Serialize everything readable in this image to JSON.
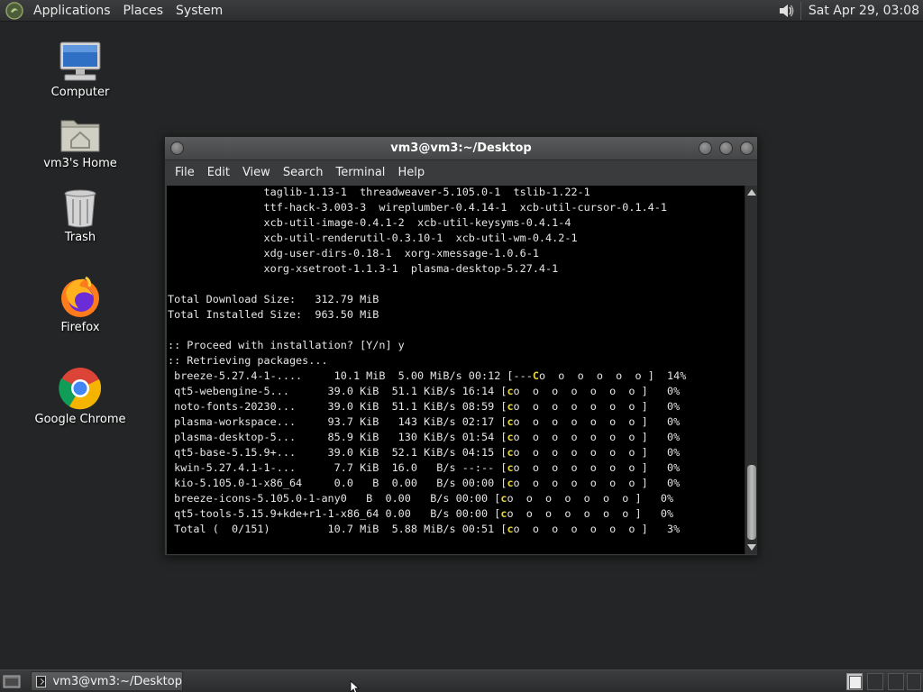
{
  "top_panel": {
    "menus": [
      "Applications",
      "Places",
      "System"
    ],
    "clock": "Sat Apr 29, 03:08",
    "volume_icon": "speaker-icon"
  },
  "desktop": {
    "icons": [
      {
        "label": "Computer",
        "icon": "computer-icon"
      },
      {
        "label": "vm3's Home",
        "icon": "home-folder-icon"
      },
      {
        "label": "Trash",
        "icon": "trash-icon"
      },
      {
        "label": "Firefox",
        "icon": "firefox-icon"
      },
      {
        "label": "Google Chrome",
        "icon": "chrome-icon"
      }
    ]
  },
  "terminal": {
    "title": "vm3@vm3:~/Desktop",
    "menus": [
      "File",
      "Edit",
      "View",
      "Search",
      "Terminal",
      "Help"
    ],
    "lines": [
      "               taglib-1.13-1  threadweaver-5.105.0-1  tslib-1.22-1",
      "               ttf-hack-3.003-3  wireplumber-0.4.14-1  xcb-util-cursor-0.1.4-1",
      "               xcb-util-image-0.4.1-2  xcb-util-keysyms-0.4.1-4",
      "               xcb-util-renderutil-0.3.10-1  xcb-util-wm-0.4.2-1",
      "               xdg-user-dirs-0.18-1  xorg-xmessage-1.0.6-1",
      "               xorg-xsetroot-1.1.3-1  plasma-desktop-5.27.4-1",
      "",
      "Total Download Size:   312.79 MiB",
      "Total Installed Size:  963.50 MiB",
      "",
      ":: Proceed with installation? [Y/n] y",
      ":: Retrieving packages...",
      " breeze-5.27.4-1-....     10.1 MiB  5.00 MiB/s 00:12 [---Co  o  o  o  o  o ]  14%",
      " qt5-webengine-5...      39.0 KiB  51.1 KiB/s 16:14 [co  o  o  o  o  o  o ]   0%",
      " noto-fonts-20230...     39.0 KiB  51.1 KiB/s 08:59 [co  o  o  o  o  o  o ]   0%",
      " plasma-workspace...     93.7 KiB   143 KiB/s 02:17 [co  o  o  o  o  o  o ]   0%",
      " plasma-desktop-5...     85.9 KiB   130 KiB/s 01:54 [co  o  o  o  o  o  o ]   0%",
      " qt5-base-5.15.9+...     39.0 KiB  52.1 KiB/s 04:15 [co  o  o  o  o  o  o ]   0%",
      " kwin-5.27.4.1-1-...      7.7 KiB  16.0   B/s --:-- [co  o  o  o  o  o  o ]   0%",
      " kio-5.105.0-1-x86_64     0.0   B  0.00   B/s 00:00 [co  o  o  o  o  o  o ]   0%",
      " breeze-icons-5.105.0-1-any0   B  0.00   B/s 00:00 [co  o  o  o  o  o  o ]   0%",
      " qt5-tools-5.15.9+kde+r1-1-x86_64 0.00   B/s 00:00 [co  o  o  o  o  o  o ]   0%",
      " Total (  0/151)         10.7 MiB  5.88 MiB/s 00:51 [co  o  o  o  o  o  o ]   3%"
    ]
  },
  "taskbar": {
    "window_button": "vm3@vm3:~/Desktop",
    "workspaces": 4
  },
  "colors": {
    "desktop_bg": "#242526",
    "terminal_bg": "#000000",
    "progress_pacman": "#e8d63a"
  }
}
